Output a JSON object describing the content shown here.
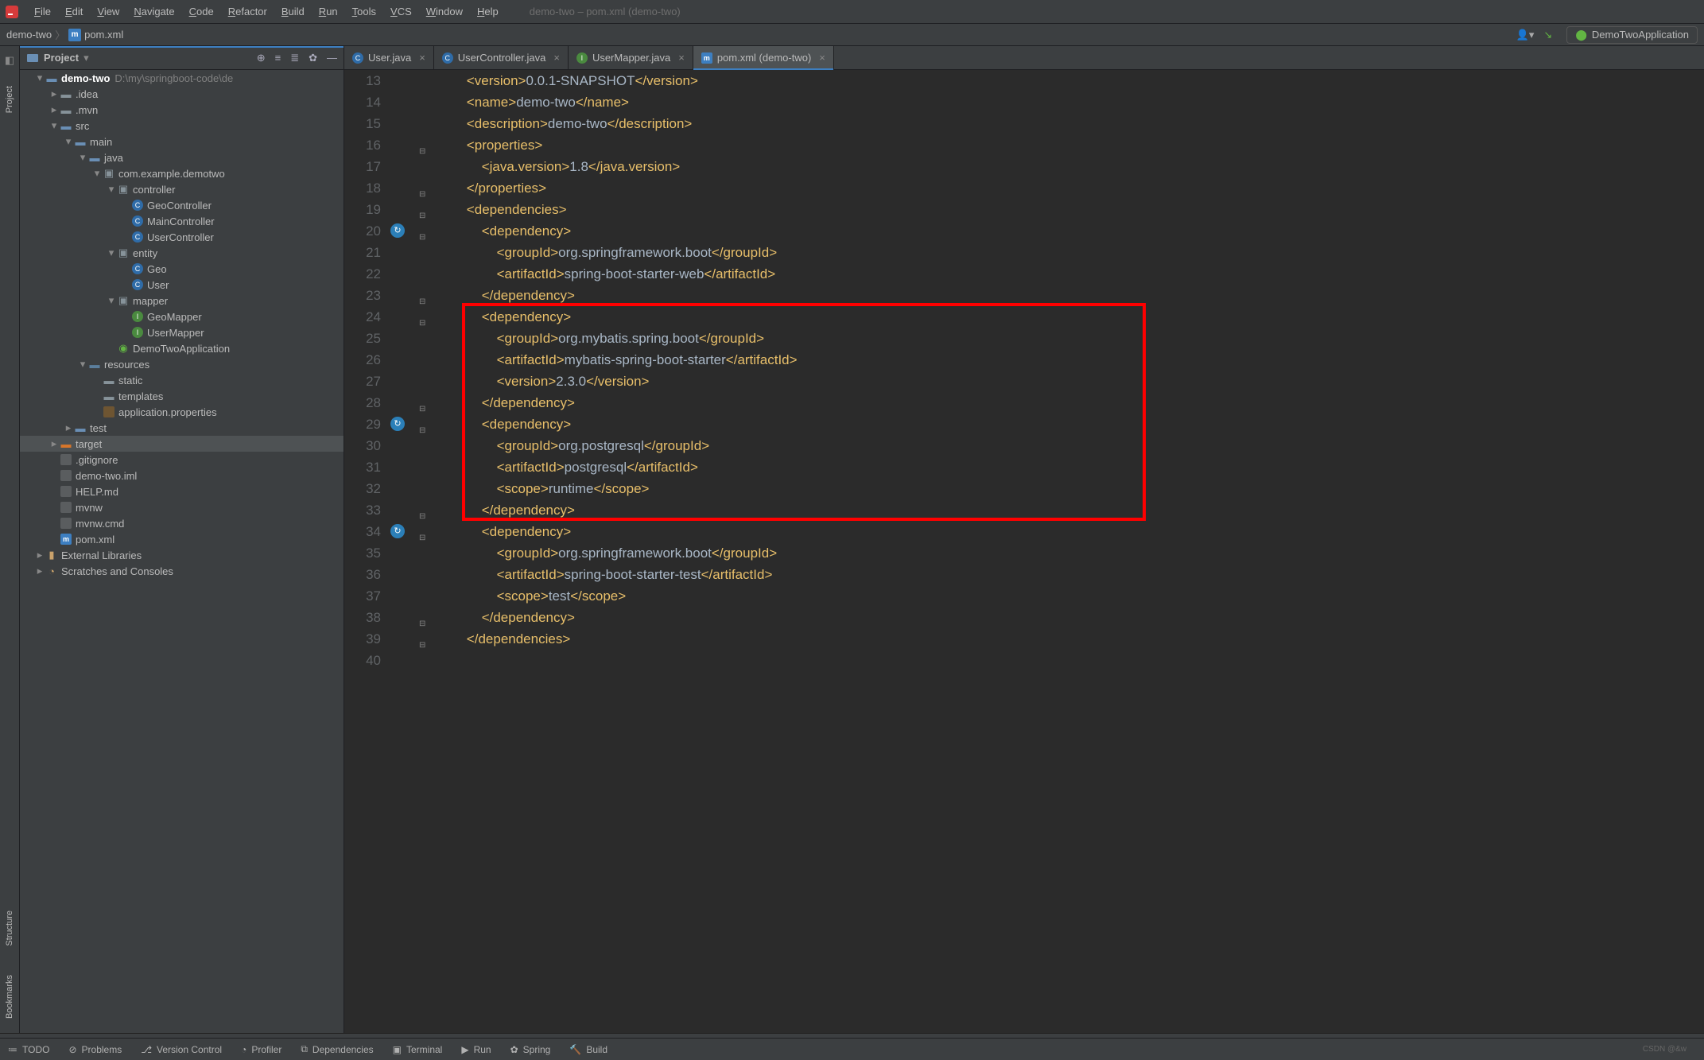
{
  "window_title": "demo-two – pom.xml (demo-two)",
  "menu": [
    "File",
    "Edit",
    "View",
    "Navigate",
    "Code",
    "Refactor",
    "Build",
    "Run",
    "Tools",
    "VCS",
    "Window",
    "Help"
  ],
  "breadcrumb": {
    "project": "demo-two",
    "file": "pom.xml"
  },
  "runconfig": "DemoTwoApplication",
  "sidebar": {
    "title": "Project"
  },
  "tree": [
    {
      "d": 0,
      "arr": "v",
      "ic": "folder-blue",
      "name": "demo-two",
      "bold": true,
      "suffix": "D:\\my\\springboot-code\\de"
    },
    {
      "d": 1,
      "arr": ">",
      "ic": "folder-grey",
      "name": ".idea"
    },
    {
      "d": 1,
      "arr": ">",
      "ic": "folder-grey",
      "name": ".mvn"
    },
    {
      "d": 1,
      "arr": "v",
      "ic": "folder-blue",
      "name": "src"
    },
    {
      "d": 2,
      "arr": "v",
      "ic": "folder-blue",
      "name": "main"
    },
    {
      "d": 3,
      "arr": "v",
      "ic": "folder-blue",
      "name": "java"
    },
    {
      "d": 4,
      "arr": "v",
      "ic": "folder-pkg",
      "name": "com.example.demotwo"
    },
    {
      "d": 5,
      "arr": "v",
      "ic": "folder-pkg",
      "name": "controller"
    },
    {
      "d": 6,
      "arr": "",
      "ic": "cls",
      "name": "GeoController"
    },
    {
      "d": 6,
      "arr": "",
      "ic": "cls",
      "name": "MainController"
    },
    {
      "d": 6,
      "arr": "",
      "ic": "cls",
      "name": "UserController"
    },
    {
      "d": 5,
      "arr": "v",
      "ic": "folder-pkg",
      "name": "entity"
    },
    {
      "d": 6,
      "arr": "",
      "ic": "cls",
      "name": "Geo"
    },
    {
      "d": 6,
      "arr": "",
      "ic": "cls",
      "name": "User"
    },
    {
      "d": 5,
      "arr": "v",
      "ic": "folder-pkg",
      "name": "mapper"
    },
    {
      "d": 6,
      "arr": "",
      "ic": "intf",
      "name": "GeoMapper"
    },
    {
      "d": 6,
      "arr": "",
      "ic": "intf",
      "name": "UserMapper"
    },
    {
      "d": 5,
      "arr": "",
      "ic": "cls-run",
      "name": "DemoTwoApplication"
    },
    {
      "d": 3,
      "arr": "v",
      "ic": "folder-res",
      "name": "resources"
    },
    {
      "d": 4,
      "arr": "",
      "ic": "folder-grey",
      "name": "static"
    },
    {
      "d": 4,
      "arr": "",
      "ic": "folder-grey",
      "name": "templates"
    },
    {
      "d": 4,
      "arr": "",
      "ic": "prop",
      "name": "application.properties"
    },
    {
      "d": 2,
      "arr": ">",
      "ic": "folder-blue",
      "name": "test"
    },
    {
      "d": 1,
      "arr": ">",
      "ic": "folder-orange",
      "name": "target",
      "sel": true
    },
    {
      "d": 1,
      "arr": "",
      "ic": "txt",
      "name": ".gitignore"
    },
    {
      "d": 1,
      "arr": "",
      "ic": "txt",
      "name": "demo-two.iml"
    },
    {
      "d": 1,
      "arr": "",
      "ic": "txt",
      "name": "HELP.md"
    },
    {
      "d": 1,
      "arr": "",
      "ic": "txt",
      "name": "mvnw"
    },
    {
      "d": 1,
      "arr": "",
      "ic": "txt",
      "name": "mvnw.cmd"
    },
    {
      "d": 1,
      "arr": "",
      "ic": "m",
      "name": "pom.xml"
    },
    {
      "d": 0,
      "arr": ">",
      "ic": "lib",
      "name": "External Libraries"
    },
    {
      "d": 0,
      "arr": ">",
      "ic": "scratch",
      "name": "Scratches and Consoles"
    }
  ],
  "editor_tabs": [
    {
      "ic": "cls",
      "label": "User.java"
    },
    {
      "ic": "cls",
      "label": "UserController.java"
    },
    {
      "ic": "intf",
      "label": "UserMapper.java"
    },
    {
      "ic": "m",
      "label": "pom.xml (demo-two)",
      "active": true
    }
  ],
  "first_line": 13,
  "code_lines": [
    {
      "i": 2,
      "raw": "<version>0.0.1-SNAPSHOT</version>"
    },
    {
      "i": 2,
      "raw": "<name>demo-two</name>"
    },
    {
      "i": 2,
      "raw": "<description>demo-two</description>"
    },
    {
      "i": 2,
      "raw": "<properties>"
    },
    {
      "i": 3,
      "raw": "<java.version>1.8</java.version>"
    },
    {
      "i": 2,
      "raw": "</properties>"
    },
    {
      "i": 2,
      "raw": "<dependencies>"
    },
    {
      "i": 3,
      "raw": "<dependency>"
    },
    {
      "i": 4,
      "raw": "<groupId>org.springframework.boot</groupId>"
    },
    {
      "i": 4,
      "raw": "<artifactId>spring-boot-starter-web</artifactId>"
    },
    {
      "i": 3,
      "raw": "</dependency>"
    },
    {
      "i": 3,
      "raw": "<dependency>"
    },
    {
      "i": 4,
      "raw": "<groupId>org.mybatis.spring.boot</groupId>"
    },
    {
      "i": 4,
      "raw": "<artifactId>mybatis-spring-boot-starter</artifactId>"
    },
    {
      "i": 4,
      "raw": "<version>2.3.0</version>"
    },
    {
      "i": 3,
      "raw": "</dependency>"
    },
    {
      "i": 3,
      "raw": "<dependency>"
    },
    {
      "i": 4,
      "raw": "<groupId>org.postgresql</groupId>"
    },
    {
      "i": 4,
      "raw": "<artifactId>postgresql</artifactId>"
    },
    {
      "i": 4,
      "raw": "<scope>runtime</scope>"
    },
    {
      "i": 3,
      "raw": "</dependency>"
    },
    {
      "i": 3,
      "raw": "<dependency>"
    },
    {
      "i": 4,
      "raw": "<groupId>org.springframework.boot</groupId>"
    },
    {
      "i": 4,
      "raw": "<artifactId>spring-boot-starter-test</artifactId>"
    },
    {
      "i": 4,
      "raw": "<scope>test</scope>"
    },
    {
      "i": 3,
      "raw": "</dependency>"
    },
    {
      "i": 2,
      "raw": "</dependencies>"
    },
    {
      "i": 0,
      "raw": ""
    }
  ],
  "markers": [
    {
      "line": 20,
      "glyph": "↻"
    },
    {
      "line": 29,
      "glyph": "↻"
    },
    {
      "line": 34,
      "glyph": "↻"
    }
  ],
  "fold_glyphs": [
    16,
    18,
    19,
    20,
    23,
    24,
    28,
    29,
    33,
    34,
    38,
    39
  ],
  "highlight_box": {
    "from_line": 24,
    "to_line": 33
  },
  "statusbar": [
    "TODO",
    "Problems",
    "Version Control",
    "Profiler",
    "Dependencies",
    "Terminal",
    "Run",
    "Spring",
    "Build"
  ],
  "side_tools": [
    "Project",
    "Bookmarks",
    "Structure"
  ],
  "watermark": "CSDN @&w"
}
